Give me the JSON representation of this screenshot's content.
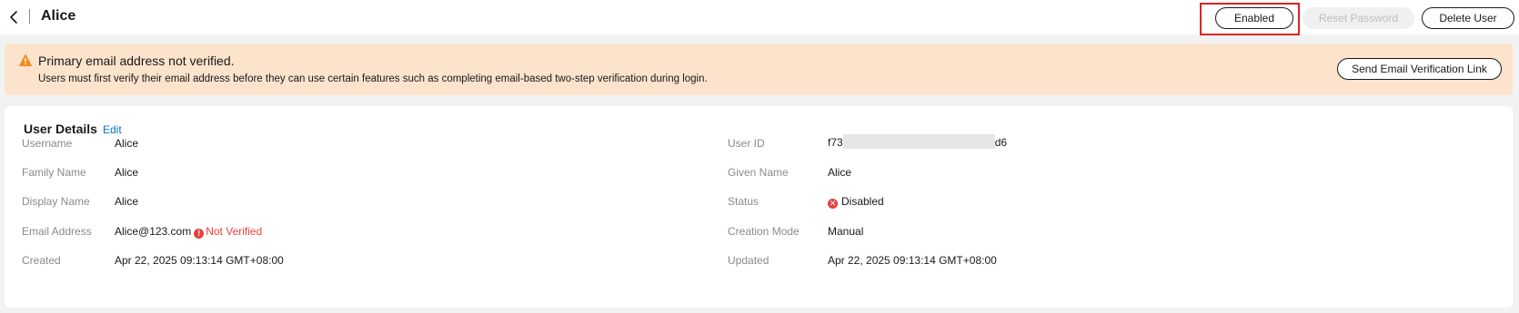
{
  "header": {
    "title": "Alice",
    "buttons": {
      "enabled": "Enabled",
      "reset_password": "Reset Password",
      "delete_user": "Delete User"
    }
  },
  "banner": {
    "title": "Primary email address not verified.",
    "description": "Users must first verify their email address before they can use certain features such as completing email-based two-step verification during login.",
    "action": "Send Email Verification Link"
  },
  "details": {
    "title": "User Details",
    "edit": "Edit",
    "left": {
      "username": {
        "label": "Username",
        "value": "Alice"
      },
      "family_name": {
        "label": "Family Name",
        "value": "Alice"
      },
      "display_name": {
        "label": "Display Name",
        "value": "Alice"
      },
      "email": {
        "label": "Email Address",
        "value": "Alice@123.com",
        "badge": "Not Verified"
      },
      "created": {
        "label": "Created",
        "value": "Apr 22, 2025 09:13:14 GMT+08:00"
      }
    },
    "right": {
      "user_id": {
        "label": "User ID",
        "prefix": "f73",
        "suffix": "d6"
      },
      "given_name": {
        "label": "Given Name",
        "value": "Alice"
      },
      "status": {
        "label": "Status",
        "value": "Disabled"
      },
      "creation_mode": {
        "label": "Creation Mode",
        "value": "Manual"
      },
      "updated": {
        "label": "Updated",
        "value": "Apr 22, 2025 09:13:14 GMT+08:00"
      }
    }
  },
  "colors": {
    "accent_link": "#0b6fd6",
    "error": "#e8403d",
    "warning_bg": "#fbe3cc",
    "warning_icon": "#f08a24",
    "highlight_frame": "#e02020"
  },
  "icons": [
    "back-arrow-icon",
    "warning-icon",
    "error-circle-icon"
  ]
}
